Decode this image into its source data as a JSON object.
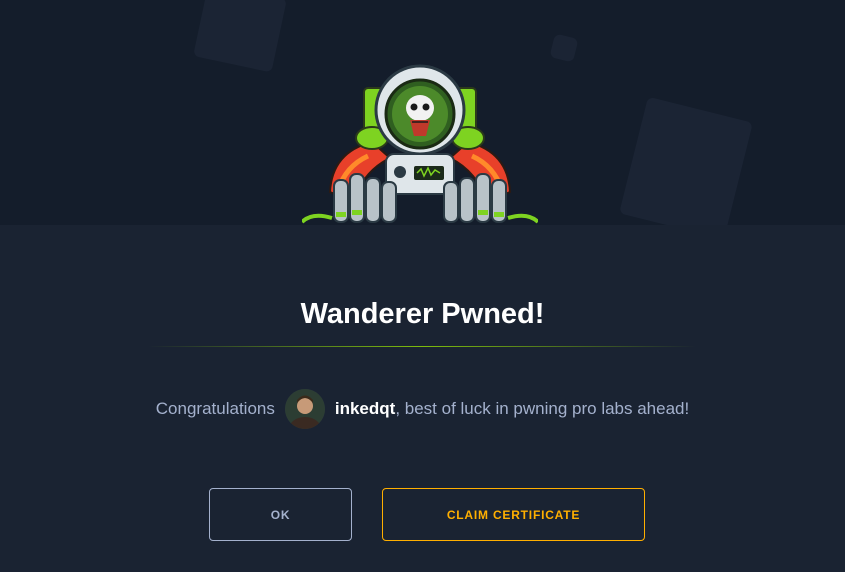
{
  "dialog": {
    "title": "Wanderer Pwned!",
    "message_prefix": "Congratulations",
    "username": "inkedqt",
    "message_suffix": ", best of luck in pwning pro labs ahead!"
  },
  "buttons": {
    "ok_label": "OK",
    "claim_label": "CLAIM CERTIFICATE"
  },
  "icons": {
    "mascot": "astronaut-skull-mascot-icon",
    "avatar": "user-avatar"
  },
  "colors": {
    "hero_background": "#141d2b",
    "body_background": "#1a2332",
    "accent_green": "#9fef00",
    "accent_orange": "#ffaf00",
    "muted_text": "#a4b1cd"
  }
}
